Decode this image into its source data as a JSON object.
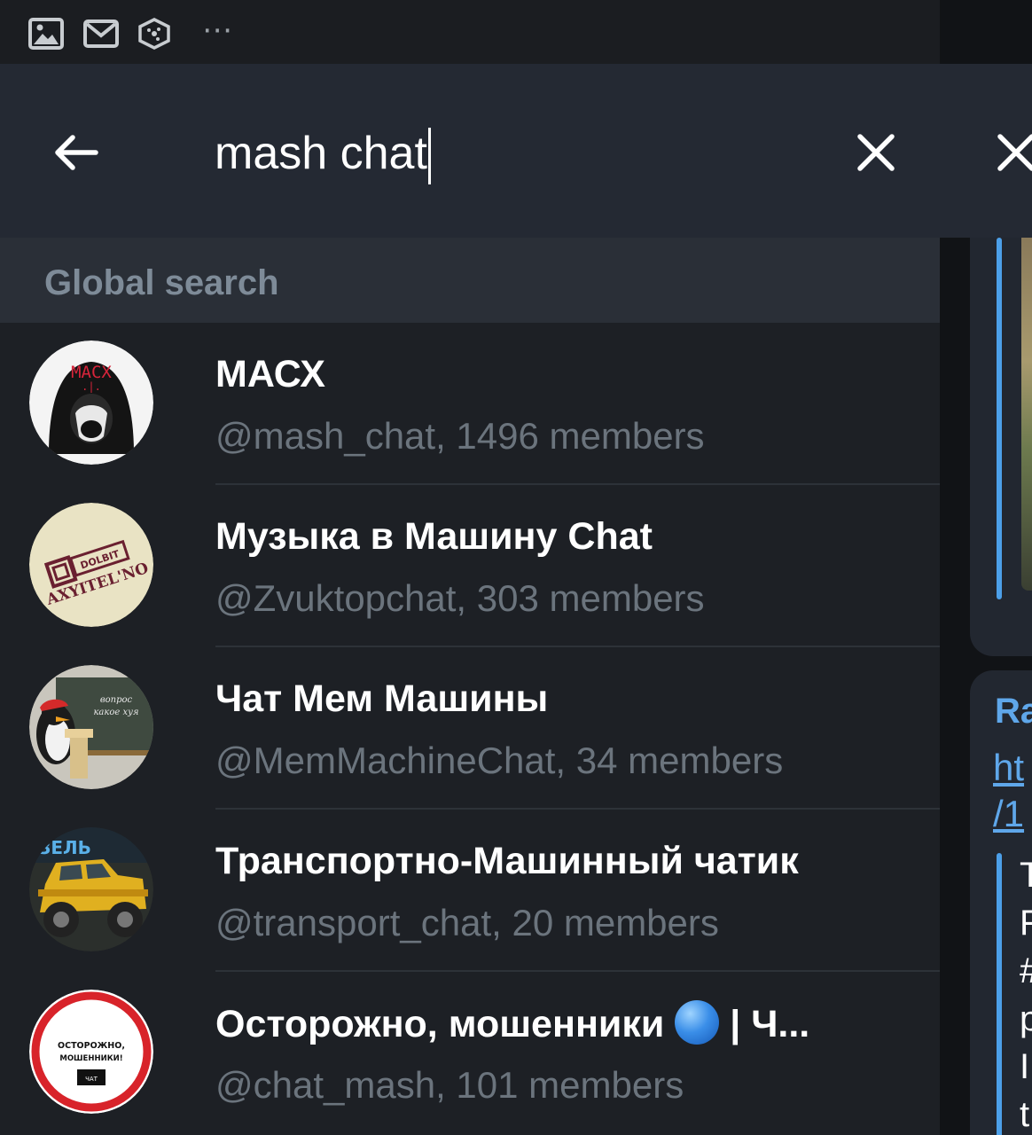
{
  "status_bar": {
    "icons": [
      "image-icon",
      "gmail-icon",
      "hexagon-app-icon"
    ],
    "more": "⋯"
  },
  "search": {
    "query": "mash chat"
  },
  "section": {
    "label": "Global search"
  },
  "results": [
    {
      "title": "МАСХ",
      "subtitle": "@mash_chat, 1496 members",
      "avatar": "mash-hooded-figure"
    },
    {
      "title": "Музыка в Машину Chat",
      "subtitle": "@Zvuktopchat, 303 members",
      "avatar": "dolbit-axyitelno-sticker"
    },
    {
      "title": "Чат Мем Машины",
      "subtitle": "@MemMachineChat, 34 members",
      "avatar": "penguin-blackboard"
    },
    {
      "title": "Транспортно-Машинный чатик",
      "subtitle": "@transport_chat, 20 members",
      "avatar": "yellow-offroad-truck"
    },
    {
      "title": "Осторожно, мошенники",
      "title_suffix": " | Ч...",
      "subtitle": "@chat_mash, 101 members",
      "avatar": "warning-sign"
    }
  ],
  "avatar_text": {
    "masx": "МАСХ",
    "dolbit": "DOLBIT",
    "axyitelno": "AXYITEL'NO",
    "board_line1": "вопрос",
    "board_line2": "какое хуя",
    "truck": "ЗЕЛЬ",
    "sign_line1": "ОСТОРОЖНО,",
    "sign_line2": "МОШЕННИКИ!",
    "sign_tag": "ЧАТ"
  },
  "right_pane": {
    "name": "Ra",
    "link_line1": "ht",
    "link_line2": "/1",
    "quote": "T\nF\n#\np\nI\nt"
  },
  "colors": {
    "header_bg": "#242933",
    "list_bg": "#1d2025",
    "section_text": "#7e8b98",
    "subtitle_text": "#6b747d",
    "accent": "#5fa7ea"
  }
}
